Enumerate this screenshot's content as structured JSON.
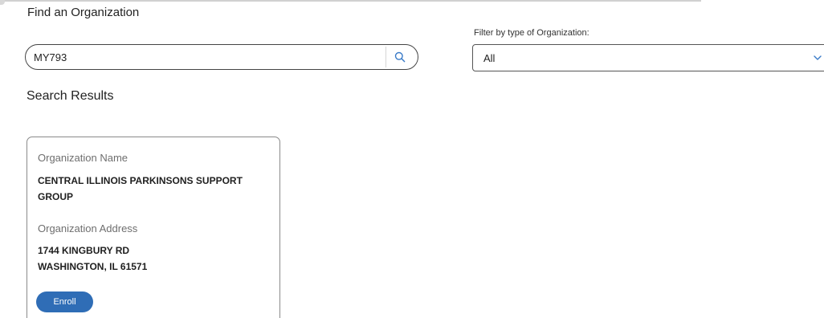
{
  "page": {
    "title": "Find an Organization"
  },
  "search": {
    "value": "MY793",
    "icon": "search-icon"
  },
  "filter": {
    "label": "Filter by type of Organization:",
    "selected": "All",
    "icon": "chevron-down-icon"
  },
  "results": {
    "title": "Search Results",
    "items": [
      {
        "name_label": "Organization Name",
        "name_line1": "CENTRAL ILLINOIS PARKINSONS SUPPORT",
        "name_line2": "GROUP",
        "address_label": "Organization Address",
        "address_line1": "1744 KINGBURY RD",
        "address_line2": "WASHINGTON, IL 61571",
        "action_label": "Enroll"
      }
    ]
  },
  "colors": {
    "accent": "#2f6db6",
    "search_icon": "#3a7bc8",
    "chevron": "#3a7bc8"
  }
}
